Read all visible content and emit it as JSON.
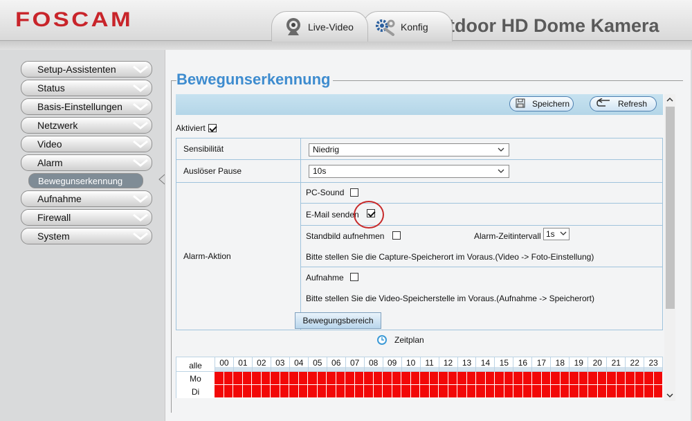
{
  "header": {
    "logo": "FOSCAM",
    "camera_title": "tdoor HD Dome Kamera",
    "tabs": [
      {
        "label": "Live-Video",
        "icon": "webcam-icon"
      },
      {
        "label": "Konfig",
        "icon": "gear-wrench-icon"
      }
    ]
  },
  "sidebar": {
    "items": [
      {
        "label": "Setup-Assistenten"
      },
      {
        "label": "Status"
      },
      {
        "label": "Basis-Einstellungen"
      },
      {
        "label": "Netzwerk"
      },
      {
        "label": "Video"
      },
      {
        "label": "Alarm"
      },
      {
        "label": "Aufnahme"
      },
      {
        "label": "Firewall"
      },
      {
        "label": "System"
      }
    ],
    "active_sub": "Bewegunserkennung"
  },
  "page": {
    "title": "Bewegunserkennung",
    "toolbar": {
      "save": "Speichern",
      "refresh": "Refresh"
    },
    "aktiviert": {
      "label": "Aktiviert",
      "checked": true
    },
    "sensibilitaet": {
      "label": "Sensibilität",
      "value": "Niedrig"
    },
    "ausloeser_pause": {
      "label": "Auslöser Pause",
      "value": "10s"
    },
    "alarm_aktion": {
      "label": "Alarm-Aktion",
      "pc_sound": {
        "label": "PC-Sound",
        "checked": false
      },
      "email": {
        "label": "E-Mail senden",
        "checked": true
      },
      "standbild": {
        "label": "Standbild aufnehmen",
        "checked": false
      },
      "intervall_label": "Alarm-Zeitintervall",
      "intervall_value": "1s",
      "capture_hint": "Bitte stellen Sie die Capture-Speicherort im Voraus.(Video -> Foto-Einstellung)",
      "aufnahme": {
        "label": "Aufnahme",
        "checked": false
      },
      "video_hint": "Bitte stellen Sie die Video-Speicherstelle im Voraus.(Aufnahme -> Speicherort)"
    },
    "bewegungsbereich_button": "Bewegungsbereich",
    "zeitplan": "Zeitplan",
    "schedule": {
      "all_label": "alle",
      "hours": [
        "00",
        "01",
        "02",
        "03",
        "04",
        "05",
        "06",
        "07",
        "08",
        "09",
        "10",
        "11",
        "12",
        "13",
        "14",
        "15",
        "16",
        "17",
        "18",
        "19",
        "20",
        "21",
        "22",
        "23"
      ],
      "days": [
        "Mo",
        "Di"
      ],
      "cells_per_hour": 2
    }
  },
  "colors": {
    "brand": "#c8242a",
    "title_blue": "#3e8ccf",
    "schedule_active": "#f20808",
    "highlight_circle": "#c72a2a"
  }
}
